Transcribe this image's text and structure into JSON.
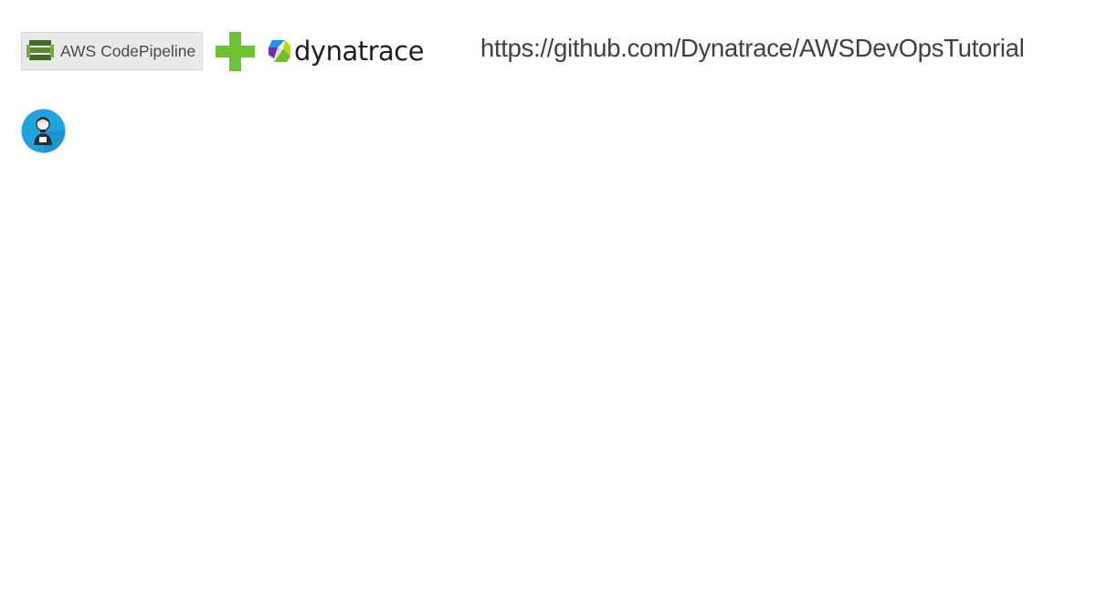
{
  "header": {
    "codepipeline_label": "AWS CodePipeline",
    "dynatrace_label": "dynatrace",
    "url": "https://github.com/Dynatrace/AWSDevOpsTutorial"
  },
  "icons": {
    "codepipeline": "codepipeline-icon",
    "plus": "plus-icon",
    "dynatrace": "dynatrace-logo-icon",
    "avatar": "presenter-avatar-icon"
  },
  "colors": {
    "plus_green": "#6cc234",
    "avatar_blue": "#1fa3dc",
    "badge_bg": "#e9e9e9",
    "codepipeline_green": "#5a7a2e",
    "url_text": "#404040"
  }
}
